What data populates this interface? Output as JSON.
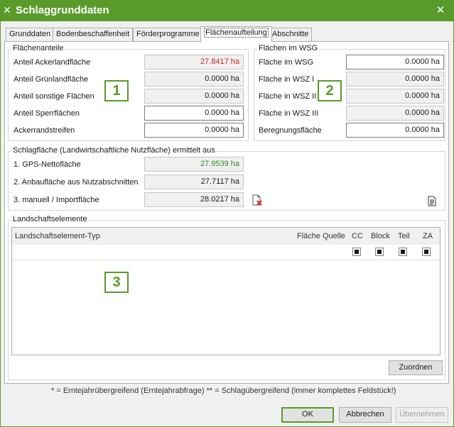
{
  "window": {
    "title": "Schlaggrunddaten",
    "app_icon": "tools-icon",
    "close_glyph": "✕"
  },
  "tabs": [
    {
      "label": "Grunddaten",
      "active": false
    },
    {
      "label": "Bodenbeschaffenheit",
      "active": false
    },
    {
      "label": "Förderprogramme",
      "active": false
    },
    {
      "label": "Flächenaufteilung",
      "active": true
    },
    {
      "label": "Abschnitte",
      "active": false
    }
  ],
  "flaechenanteile": {
    "title": "Flächenanteile",
    "rows": [
      {
        "label": "Anteil Ackerlandfläche",
        "value": "27.8417 ha"
      },
      {
        "label": "Anteil Grünlandfläche",
        "value": "0.0000 ha"
      },
      {
        "label": "Anteil sonstige Flächen",
        "value": "0.0000 ha"
      },
      {
        "label": "Anteil Sperrflächen",
        "value": "0.0000 ha"
      },
      {
        "label": "Ackerrandstreifen",
        "value": "0.0000 ha"
      }
    ]
  },
  "wsg": {
    "title": "Flächen im WSG",
    "rows": [
      {
        "label": "Fläche im WSG",
        "value": "0.0000 ha"
      },
      {
        "label": "Fläche in WSZ I",
        "value": "0.0000 ha"
      },
      {
        "label": "Fläche in WSZ II",
        "value": "0.0000 ha"
      },
      {
        "label": "Fläche in WSZ III",
        "value": "0.0000 ha"
      },
      {
        "label": "Beregnungsfläche",
        "value": "0.0000 ha"
      }
    ]
  },
  "schlagflaeche": {
    "title": "Schlagfläche (Landwirtschaftliche Nutzfläche) ermittelt aus",
    "rows": [
      {
        "label": "1. GPS-Nettofläche",
        "value": "27.9539 ha"
      },
      {
        "label": "2. Anbaufläche aus Nutzabschnitten",
        "value": "27.7117 ha"
      },
      {
        "label": "3. manuell / Importfläche",
        "value": "28.0217 ha"
      }
    ]
  },
  "landschaft": {
    "title": "Landschaftselemente",
    "columns": [
      "Landschaftselement-Typ",
      "Fläche",
      "Quelle",
      "CC",
      "Block",
      "Teil",
      "ZA"
    ],
    "assign_button": "Zuordnen"
  },
  "callouts": [
    "1",
    "2",
    "3"
  ],
  "footnote": "* = Erntejahrübergreifend (Erntejahrabfrage)   ** = Schlagübergreifend (immer komplettes Feldstück!)",
  "buttons": {
    "ok": "OK",
    "cancel": "Abbrechen",
    "apply": "Übernehmen"
  },
  "colors": {
    "accent": "#5a9a2a",
    "red_value": "#d21f1f",
    "green_value": "#2a8a2a"
  }
}
